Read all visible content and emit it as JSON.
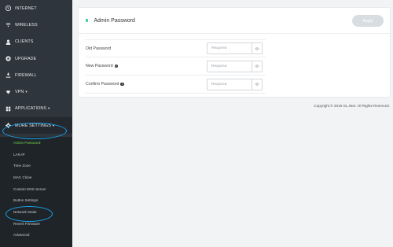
{
  "sidebar": {
    "items": [
      {
        "label": "INTERNET",
        "icon": "globe-icon"
      },
      {
        "label": "WIRELESS",
        "icon": "wifi-icon"
      },
      {
        "label": "CLIENTS",
        "icon": "user-icon"
      },
      {
        "label": "UPGRADE",
        "icon": "upgrade-icon"
      },
      {
        "label": "FIREWALL",
        "icon": "firewall-icon"
      },
      {
        "label": "VPN",
        "icon": "shield-icon",
        "caret": "▾"
      },
      {
        "label": "APPLICATIONS",
        "icon": "grid-icon",
        "caret": "▾"
      },
      {
        "label": "MORE SETTINGS",
        "icon": "gear-icon",
        "caret": "▾"
      }
    ],
    "submenu": [
      {
        "label": "Admin Password",
        "active": true
      },
      {
        "label": "LAN IP"
      },
      {
        "label": "Time Zone"
      },
      {
        "label": "MAC Clone"
      },
      {
        "label": "Custom DNS Server"
      },
      {
        "label": "Button Settings"
      },
      {
        "label": "Network Mode"
      },
      {
        "label": "Revert Firmware"
      },
      {
        "label": "Advanced"
      }
    ]
  },
  "panel": {
    "title": "Admin Password",
    "apply_label": "Apply",
    "fields": [
      {
        "label": "Old Password",
        "placeholder": "Required",
        "info": ""
      },
      {
        "label": "New Password",
        "placeholder": "Required",
        "info": "i"
      },
      {
        "label": "Confirm Password",
        "placeholder": "Required",
        "info": "i"
      }
    ]
  },
  "footer": {
    "copyright": "Copyright © 2019 GL.iNet. All Rights Reserved."
  },
  "colors": {
    "sidebar_bg": "#2e353d",
    "submenu_bg": "#1f2429",
    "active_green": "#6fd44a",
    "accent_dot": "#36c9a0",
    "annotation_blue": "#1aa1e6",
    "apply_disabled": "#d8dde2"
  }
}
